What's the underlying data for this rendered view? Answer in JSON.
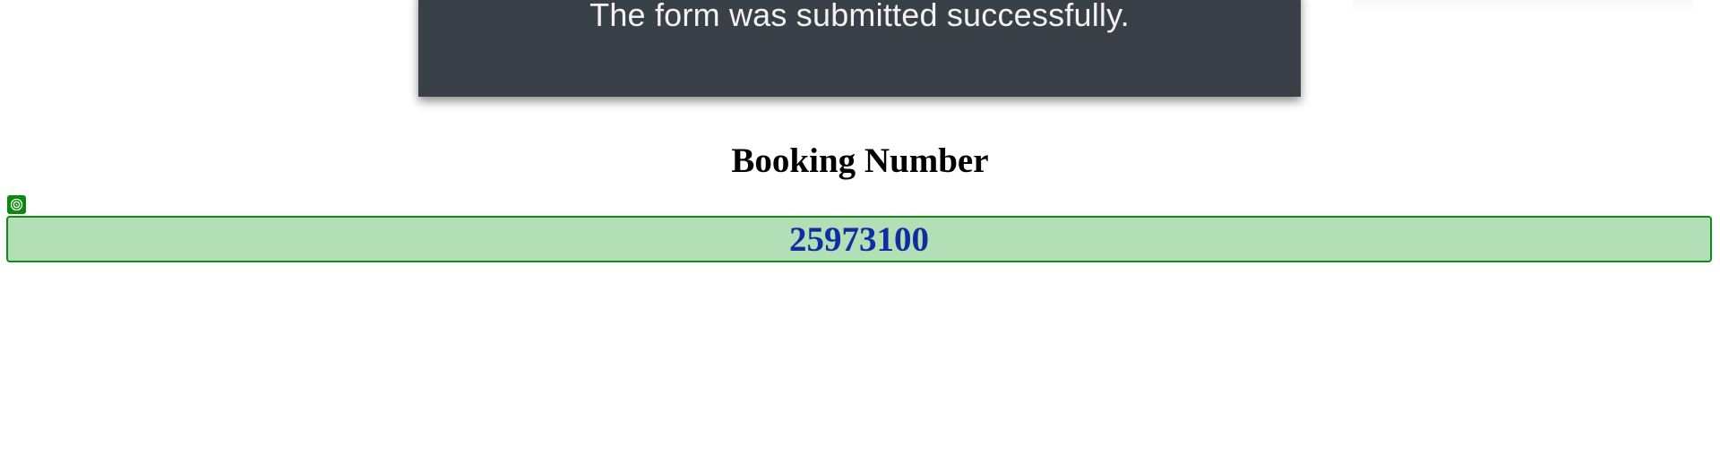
{
  "toast": {
    "message": "The form was submitted successfully."
  },
  "booking": {
    "heading": "Booking Number",
    "number": "25973100",
    "badge_icon": "target-icon"
  },
  "colors": {
    "toast_bg": "#3a4048",
    "toast_text": "#f2f2f2",
    "box_bg": "#b3dfb6",
    "box_border": "#13891a",
    "number_text": "#0f2fa0",
    "badge_bg": "#0a8a0a"
  }
}
